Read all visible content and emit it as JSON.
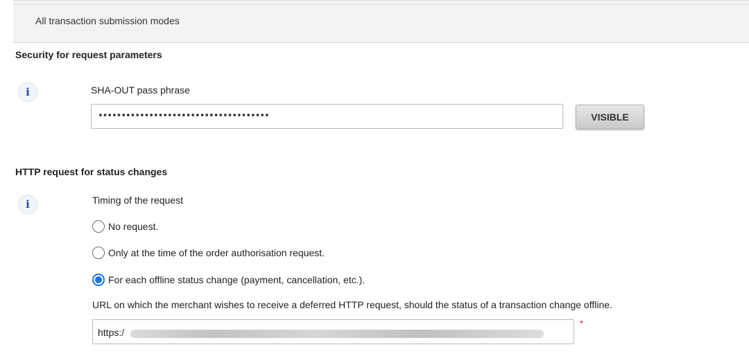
{
  "header": {
    "tab_label": "All transaction submission modes"
  },
  "security_section": {
    "title": "Security for request parameters",
    "info_icon": "info-icon",
    "sha_out_label": "SHA-OUT pass phrase",
    "sha_out_value": "•••••••••••••••••••••••••••••••••••••",
    "visible_button_label": "VISIBLE"
  },
  "http_section": {
    "title": "HTTP request for status changes",
    "info_icon": "info-icon",
    "timing_label": "Timing of the request",
    "options": [
      {
        "label": "No request.",
        "checked": false
      },
      {
        "label": "Only at the time of the order authorisation request.",
        "checked": false
      },
      {
        "label": "For each offline status change (payment, cancellation, etc.).",
        "checked": true
      }
    ],
    "url_label": "URL on which the merchant wishes to receive a deferred HTTP request, should the status of a transaction change offline.",
    "url_value_prefix": "https:/",
    "required_marker": "*"
  },
  "colors": {
    "radio_checked": "#1a73e8",
    "required": "#d0021b",
    "info_icon": "#2a4b8d"
  }
}
